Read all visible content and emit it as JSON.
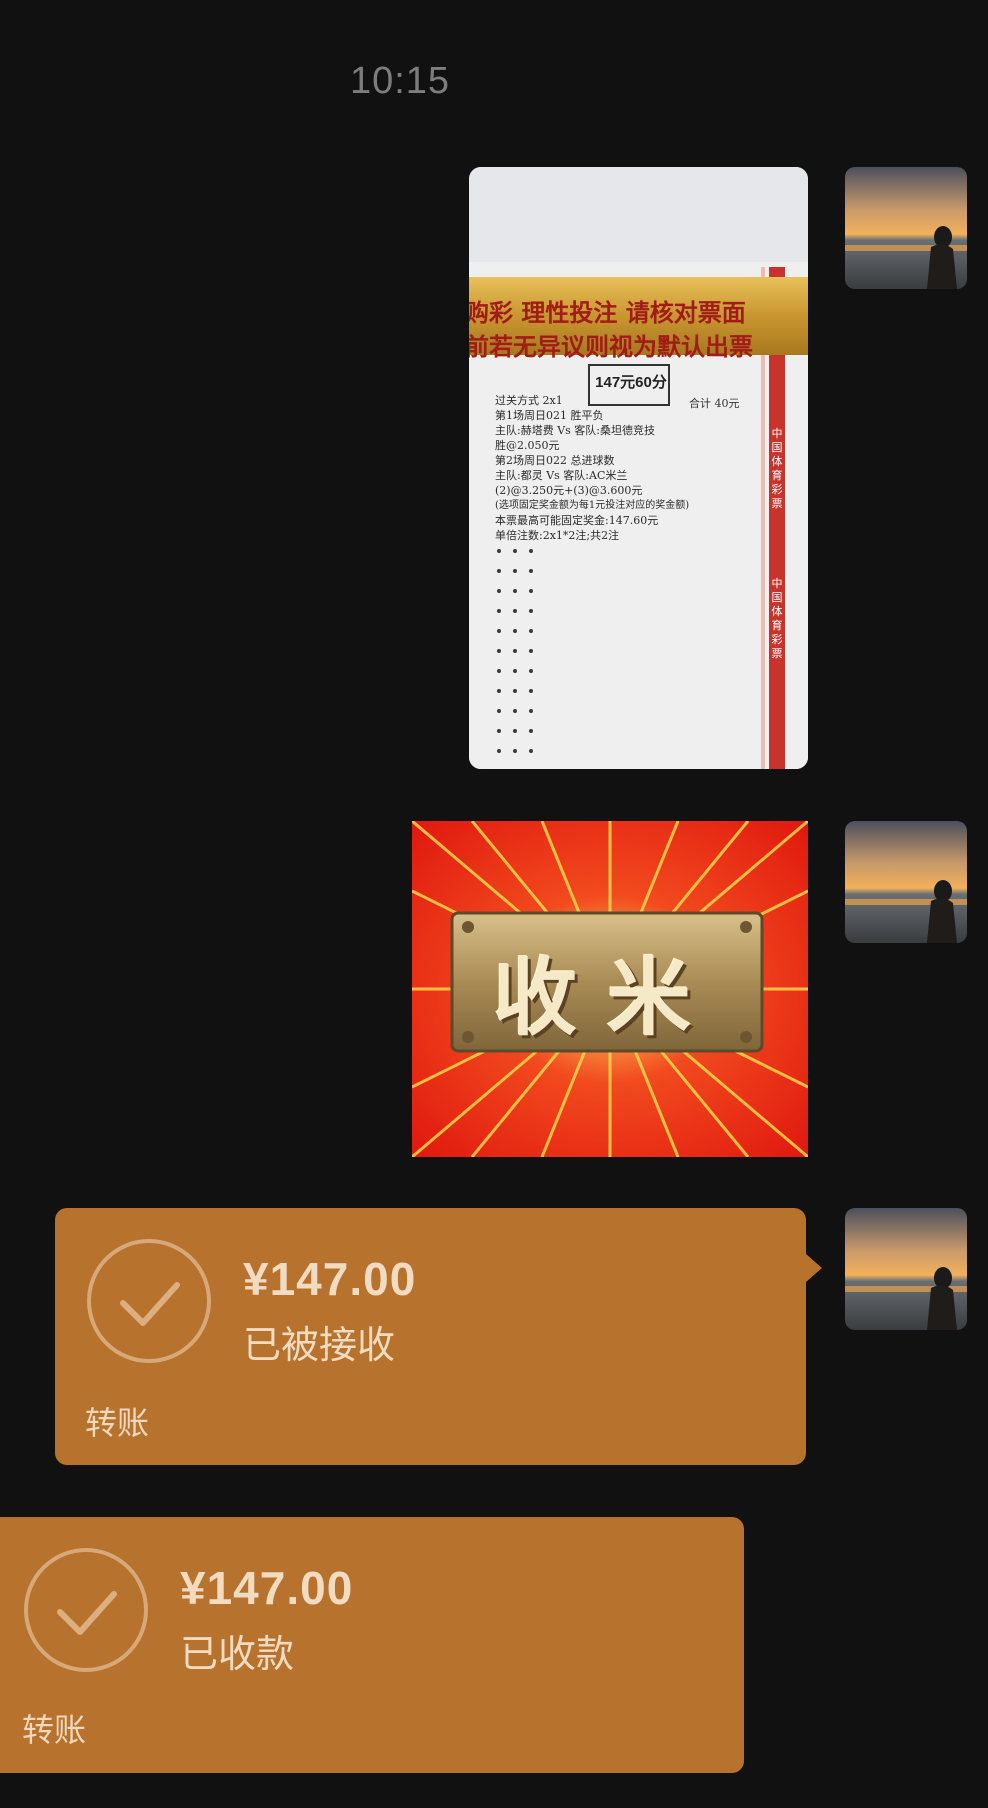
{
  "chat": {
    "timestamp": "10:15"
  },
  "messages": [
    {
      "type": "image",
      "description_icon": "lottery-ticket-photo",
      "ticket": {
        "banner_line1": "购彩  理性投注  请核对票面",
        "banner_line2": "前若无异议则视为默认出票",
        "stamp": "147元60分",
        "lines": [
          "过关方式 2x1",
          "第1场周日021 胜平负",
          "主队:赫塔费 Vs 客队:桑坦德竞技",
          "胜@2.050元",
          "第2场周日022 总进球数",
          "主队:都灵 Vs 客队:AC米兰",
          "(2)@3.250元+(3)@3.600元",
          "(选项固定奖金额为每1元投注对应的奖金额)",
          "本票最高可能固定奖金:147.60元",
          "单倍注数:2x1*2注;共2注"
        ],
        "total": "合计 40元",
        "side_text": "中国体育彩票"
      }
    },
    {
      "type": "sticker",
      "text": "收米"
    },
    {
      "type": "transfer",
      "amount": "¥147.00",
      "status": "已被接收",
      "kind": "转账"
    },
    {
      "type": "transfer",
      "amount": "¥147.00",
      "status": "已收款",
      "kind": "转账"
    }
  ],
  "colors": {
    "background": "#111111",
    "transfer_bubble": "#b7722e",
    "transfer_text": "#f1dcc2",
    "timestamp": "#7d7d7d"
  }
}
